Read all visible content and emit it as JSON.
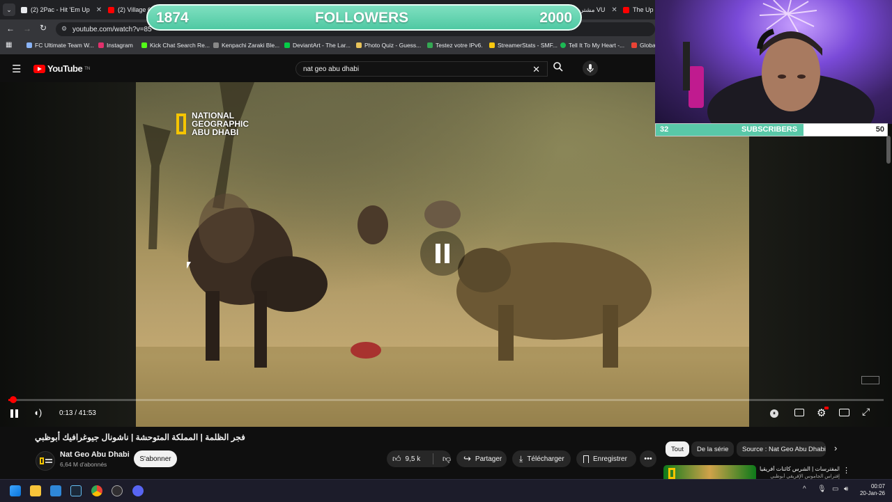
{
  "browser": {
    "tabs": [
      {
        "label": "(2) 2Pac - Hit 'Em Up",
        "color": "#e8eaed"
      },
      {
        "label": "(2) Village C",
        "color": "#ff0000"
      },
      {
        "label": "The Up I",
        "color": "#ff0000"
      }
    ],
    "rtl_tab_label": "(2) مشترين VU",
    "url": "youtube.com/watch?v=85",
    "bookmarks": [
      "FC Ultimate Team W...",
      "Instagram",
      "Kick Chat Search Re...",
      "Kenpachi Zaraki Ble...",
      "DeviantArt - The Lar...",
      "Photo Quiz - Guess...",
      "Testez votre IPv6.",
      "StreamerStats - SMF...",
      "Tell It To My Heart -...",
      "Globa"
    ]
  },
  "youtube": {
    "logo": "YouTube",
    "logo_sup": "TN",
    "search_value": "nat geo abu dhabi"
  },
  "video": {
    "watermark": [
      "NATIONAL",
      "GEOGRAPHIC",
      "ABU DHABI"
    ],
    "time": "0:13 / 41:53",
    "progress_fraction": 0.0052,
    "title": "فجر الظلمة | المملكة المتوحشة | ناشونال جيوغرافيك أبوظبي"
  },
  "channel": {
    "name": "Nat Geo Abu Dhabi",
    "subscribers": "6,64 M d'abonnés",
    "subscribe_label": "S'abonner"
  },
  "actions": {
    "likes": "9,5 k",
    "share": "Partager",
    "download": "Télécharger",
    "save": "Enregistrer"
  },
  "chips": [
    "Tout",
    "De la série",
    "Source : Nat Geo Abu Dhabi"
  ],
  "related": {
    "title": "جنة المفترسات | الشرس كائنات أفريقيا",
    "subtitle": "إفتراس الجاموس الإفريقي أبوظبي"
  },
  "overlay": {
    "followers_current": "1874",
    "followers_label": "FOLLOWERS",
    "followers_goal": "2000",
    "subs_current": "32",
    "subs_label": "SUBSCRIBERS",
    "subs_goal": "50",
    "subs_fraction": 0.64
  },
  "taskbar": {
    "time": "00:07",
    "date": "20-Jan-26"
  }
}
